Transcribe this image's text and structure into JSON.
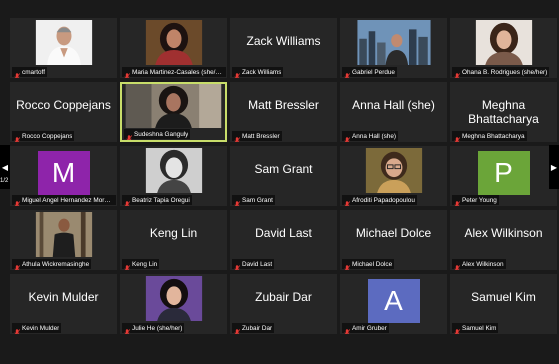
{
  "participants": [
    {
      "display": "",
      "label": "cmartoff",
      "kind": "photo",
      "photo": "man-white"
    },
    {
      "display": "",
      "label": "Maria Martinez-Casales (she/her)",
      "kind": "photo",
      "photo": "woman-curly-dark"
    },
    {
      "display": "Zack Williams",
      "label": "Zack Williams",
      "kind": "name"
    },
    {
      "display": "",
      "label": "Gabriel Perdue",
      "kind": "photo",
      "photo": "city"
    },
    {
      "display": "",
      "label": "Ohana B. Rodrigues (she/her)",
      "kind": "photo",
      "photo": "woman-light"
    },
    {
      "display": "Rocco Coppejans",
      "label": "Rocco Coppejans",
      "kind": "name"
    },
    {
      "display": "",
      "label": "Sudeshna Ganguly",
      "kind": "photo",
      "photo": "woman-video",
      "active": true
    },
    {
      "display": "Matt Bressler",
      "label": "Matt Bressler",
      "kind": "name"
    },
    {
      "display": "Anna Hall (she)",
      "label": "Anna Hall (she)",
      "kind": "name"
    },
    {
      "display": "Meghna Bhattacharya",
      "label": "Meghna Bhattacharya",
      "kind": "name"
    },
    {
      "display": "M",
      "label": "Miguel Angel Hernandez Morales",
      "kind": "avatar",
      "color": "#8e24aa"
    },
    {
      "display": "",
      "label": "Beatriz Tapia Oregui",
      "kind": "photo",
      "photo": "bw-woman"
    },
    {
      "display": "Sam Grant",
      "label": "Sam Grant",
      "kind": "name"
    },
    {
      "display": "",
      "label": "Afroditi Papadopoulou",
      "kind": "photo",
      "photo": "woman-glasses"
    },
    {
      "display": "P",
      "label": "Peter Young",
      "kind": "avatar",
      "color": "#6ba539"
    },
    {
      "display": "",
      "label": "Athula Wickremasinghe",
      "kind": "photo",
      "photo": "man-woods"
    },
    {
      "display": "Keng Lin",
      "label": "Keng Lin",
      "kind": "name"
    },
    {
      "display": "David Last",
      "label": "David Last",
      "kind": "name"
    },
    {
      "display": "Michael Dolce",
      "label": "Michael Dolce",
      "kind": "name"
    },
    {
      "display": "Alex Wilkinson",
      "label": "Alex Wilkinson",
      "kind": "name"
    },
    {
      "display": "Kevin Mulder",
      "label": "Kevin Mulder",
      "kind": "name"
    },
    {
      "display": "",
      "label": "Julie He (she/her)",
      "kind": "photo",
      "photo": "woman-purple"
    },
    {
      "display": "Zubair Dar",
      "label": "Zubair Dar",
      "kind": "name"
    },
    {
      "display": "A",
      "label": "Amir Gruber",
      "kind": "avatar",
      "color": "#5c6bc0"
    },
    {
      "display": "Samuel Kim",
      "label": "Samuel Kim",
      "kind": "name"
    }
  ],
  "pager": {
    "left_page": "1/2",
    "right_page": "1/2"
  },
  "colors": {
    "mic_muted": "#e53935",
    "active_border": "#c8dd6a",
    "tile_bg": "#262626"
  }
}
